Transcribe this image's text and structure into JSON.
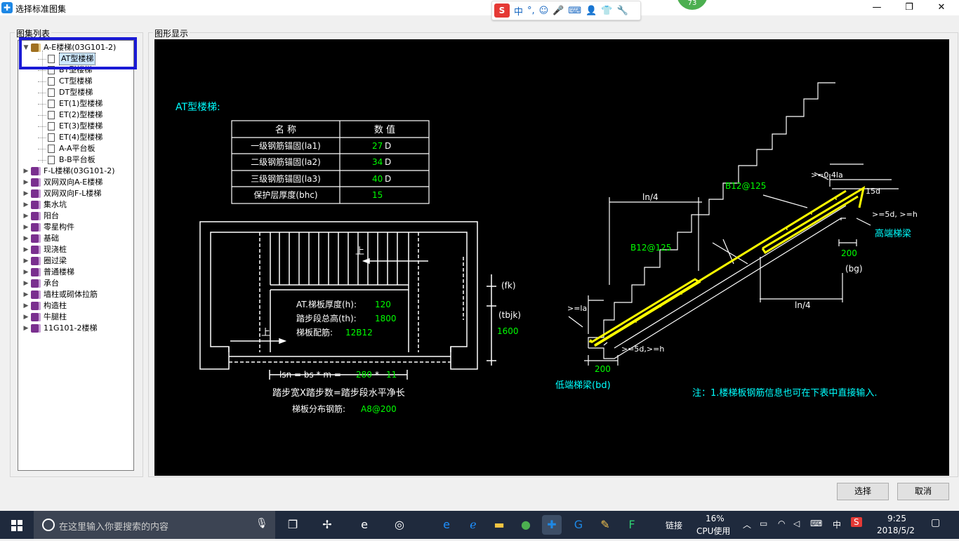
{
  "window": {
    "title": "选择标准图集",
    "min": "—",
    "max": "❐",
    "close": "✕"
  },
  "ime": {
    "logo": "S",
    "items": [
      "中",
      "°,",
      "☺",
      "🎤",
      "⌨",
      "👤",
      "👕",
      "🔧"
    ]
  },
  "badge": "73",
  "tree_panel": {
    "label": "图集列表",
    "items": [
      {
        "label": "A-E楼梯(03G101-2)",
        "level": 0,
        "icon": "open-book",
        "expanded": true
      },
      {
        "label": "AT型楼梯",
        "level": 1,
        "icon": "doc",
        "selected": true
      },
      {
        "label": "BT型楼梯",
        "level": 1,
        "icon": "doc"
      },
      {
        "label": "CT型楼梯",
        "level": 1,
        "icon": "doc"
      },
      {
        "label": "DT型楼梯",
        "level": 1,
        "icon": "doc"
      },
      {
        "label": "ET(1)型楼梯",
        "level": 1,
        "icon": "doc"
      },
      {
        "label": "ET(2)型楼梯",
        "level": 1,
        "icon": "doc"
      },
      {
        "label": "ET(3)型楼梯",
        "level": 1,
        "icon": "doc"
      },
      {
        "label": "ET(4)型楼梯",
        "level": 1,
        "icon": "doc"
      },
      {
        "label": "A-A平台板",
        "level": 1,
        "icon": "doc"
      },
      {
        "label": "B-B平台板",
        "level": 1,
        "icon": "doc"
      },
      {
        "label": "F-L楼梯(03G101-2)",
        "level": 0,
        "icon": "book"
      },
      {
        "label": "双网双向A-E楼梯",
        "level": 0,
        "icon": "book"
      },
      {
        "label": "双网双向F-L楼梯",
        "level": 0,
        "icon": "book"
      },
      {
        "label": "集水坑",
        "level": 0,
        "icon": "book"
      },
      {
        "label": "阳台",
        "level": 0,
        "icon": "book"
      },
      {
        "label": "零星构件",
        "level": 0,
        "icon": "book"
      },
      {
        "label": "基础",
        "level": 0,
        "icon": "book"
      },
      {
        "label": "现浇桩",
        "level": 0,
        "icon": "book"
      },
      {
        "label": "圈过梁",
        "level": 0,
        "icon": "book"
      },
      {
        "label": "普通楼梯",
        "level": 0,
        "icon": "book"
      },
      {
        "label": "承台",
        "level": 0,
        "icon": "book"
      },
      {
        "label": "墙柱或砌体拉筋",
        "level": 0,
        "icon": "book"
      },
      {
        "label": "构造柱",
        "level": 0,
        "icon": "book"
      },
      {
        "label": "牛腿柱",
        "level": 0,
        "icon": "book"
      },
      {
        "label": "11G101-2楼梯",
        "level": 0,
        "icon": "book"
      }
    ]
  },
  "drawing_panel": {
    "label": "图形显示",
    "heading": "AT型楼梯:",
    "table": {
      "headers": [
        "名  称",
        "数  值"
      ],
      "rows": [
        {
          "name": "一级钢筋锚固(la1)",
          "value": "27",
          "unit": "D"
        },
        {
          "name": "二级钢筋锚固(la2)",
          "value": "34",
          "unit": "D"
        },
        {
          "name": "三级钢筋锚固(la3)",
          "value": "40",
          "unit": "D"
        },
        {
          "name": "保护层厚度(bhc)",
          "value": "15",
          "unit": ""
        }
      ]
    },
    "plan": {
      "up1": "上",
      "up2": "上",
      "thickness_label": "AT.梯板厚度(h):",
      "thickness_value": "120",
      "height_label": "踏步段总高(th):",
      "height_value": "1800",
      "rebar_label": "梯板配筋:",
      "rebar_value": "12B12",
      "fk": "(fk)",
      "tbjk": "(tbjk)",
      "tbjk_value": "1600",
      "lsn_label": "lsn = bs * m =",
      "bs_value": "280",
      "times": "*",
      "m_value": "11",
      "formula": "踏步宽X踏步数=踏步段水平净长",
      "dist_label": "梯板分布钢筋:",
      "dist_value": "A8@200"
    },
    "section": {
      "b12_upper": "B12@125",
      "b12_lower": "B12@125",
      "ln4_top": "ln/4",
      "ln4_bottom": "ln/4",
      "top_la": ">=0.4la",
      "d15": "15d",
      "d5h_high": ">=5d, >=h",
      "high_beam": "高端梯梁",
      "val200_high": "200",
      "bg": "(bg)",
      "la_low": ">=la",
      "d5h_low": ">=5d,>=h",
      "val200_low": "200",
      "low_beam": "低端梯梁(bd)",
      "note": "注：1.楼梯板钢筋信息也可在下表中直接输入."
    }
  },
  "buttons": {
    "select": "选择",
    "cancel": "取消"
  },
  "taskbar": {
    "search_placeholder": "在这里输入你要搜索的内容",
    "link_label": "链接",
    "cpu_pct": "16%",
    "cpu_label": "CPU使用",
    "ime_lang": "中",
    "time": "9:25",
    "date": "2018/5/2"
  },
  "colors": {
    "canvas_bg": "#000000",
    "drawing_line": "#ffffff",
    "value_green": "#00ff00",
    "label_cyan": "#00ffff",
    "rebar_yellow": "#ffff00",
    "select_highlight": "#1a1ad6"
  }
}
